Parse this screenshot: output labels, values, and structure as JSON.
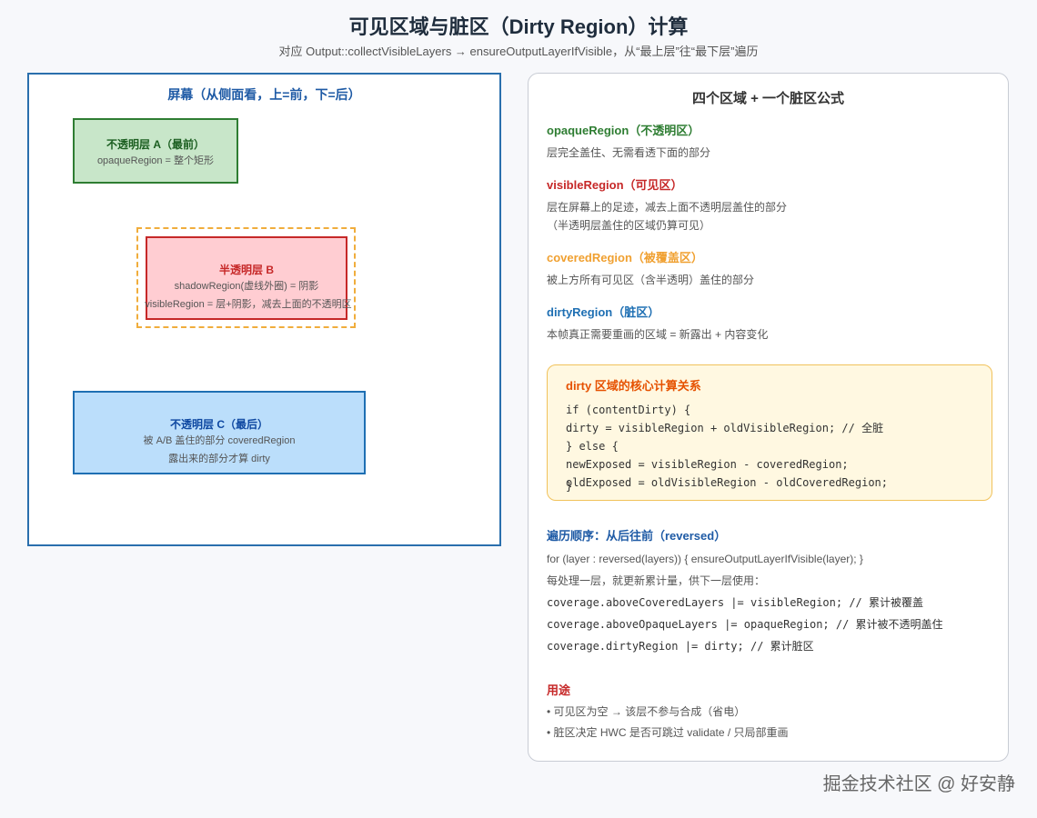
{
  "header": {
    "title": "可见区域与脏区（Dirty Region）计算",
    "subtitle": "对应 Output::collectVisibleLayers → ensureOutputLayerIfVisible，从“最上层”往“最下层”遍历"
  },
  "screen": {
    "title": "屏幕（从侧面看，上=前，下=后）",
    "layer_a": {
      "title": "不透明层 A（最前）",
      "line1": "opaqueRegion = 整个矩形"
    },
    "layer_b": {
      "title": "半透明层 B",
      "line1": "shadowRegion(虚线外圈) = 阴影",
      "line2": "visibleRegion = 层+阴影，减去上面的不透明区"
    },
    "layer_c": {
      "title": "不透明层 C（最后）",
      "line1": "被 A/B 盖住的部分 coveredRegion",
      "line2": "露出来的部分才算 dirty"
    }
  },
  "info": {
    "title": "四个区域 + 一个脏区公式",
    "regions": [
      {
        "name": "opaqueRegion（不透明区）",
        "desc1": "层完全盖住、无需看透下面的部分",
        "desc2": "",
        "color": "#2e7d32"
      },
      {
        "name": "visibleRegion（可见区）",
        "desc1": "层在屏幕上的足迹，减去上面不透明层盖住的部分",
        "desc2": "（半透明层盖住的区域仍算可见）",
        "color": "#c62828"
      },
      {
        "name": "coveredRegion（被覆盖区）",
        "desc1": "被上方所有可见区（含半透明）盖住的部分",
        "desc2": "",
        "color": "#f0a030"
      },
      {
        "name": "dirtyRegion（脏区）",
        "desc1": "本帧真正需要重画的区域 = 新露出 + 内容变化",
        "desc2": "",
        "color": "#1e6fb3"
      }
    ],
    "dirty_box": {
      "title": "dirty 区域的核心计算关系",
      "code": [
        "if (contentDirty) {",
        "dirty = visibleRegion + oldVisibleRegion; // 全脏",
        "} else {",
        "newExposed = visibleRegion - coveredRegion;",
        "oldExposed = oldVisibleRegion - oldCoveredRegion;"
      ],
      "closing": "}"
    },
    "traverse": {
      "title": "遍历顺序：从后往前（reversed）",
      "loop": "for (layer : reversed(layers)) { ensureOutputLayerIfVisible(layer); }",
      "note": "每处理一层，就更新累计量，供下一层使用：",
      "code": [
        "coverage.aboveCoveredLayers |= visibleRegion; // 累计被覆盖",
        "coverage.aboveOpaqueLayers |= opaqueRegion; // 累计被不透明盖住",
        "coverage.dirtyRegion |= dirty; // 累计脏区"
      ]
    },
    "usage": {
      "title": "用途",
      "items": [
        "• 可见区为空 → 该层不参与合成（省电）",
        "• 脏区决定 HWC 是否可跳过 validate / 只局部重画"
      ]
    }
  },
  "watermark": "掘金技术社区 @ 好安静"
}
